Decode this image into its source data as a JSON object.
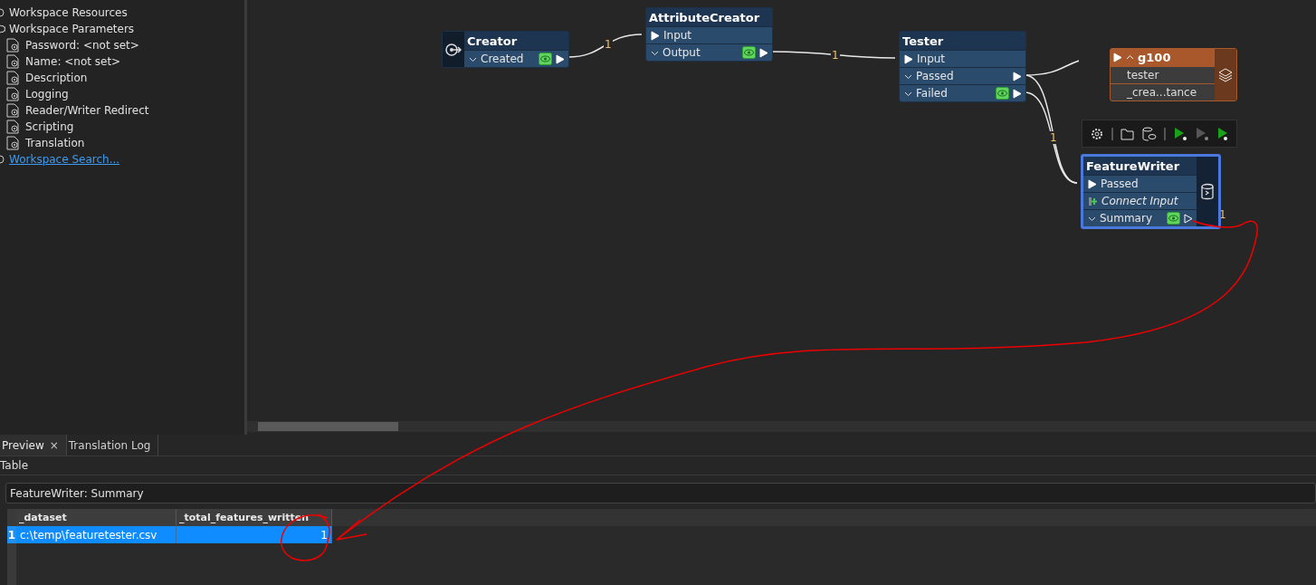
{
  "navigator": {
    "items": [
      {
        "label": "Workspace Resources",
        "kind": "resources"
      },
      {
        "label": "Workspace Parameters",
        "kind": "parameters",
        "children": [
          {
            "label": "Password: <not set>"
          },
          {
            "label": "Name: <not set>"
          },
          {
            "label": "Description"
          },
          {
            "label": "Logging"
          },
          {
            "label": "Reader/Writer Redirect"
          },
          {
            "label": "Scripting"
          },
          {
            "label": "Translation"
          }
        ]
      }
    ],
    "search_link": "Workspace Search..."
  },
  "canvas": {
    "nodes": [
      {
        "kind": "creator",
        "title": "Creator",
        "selected": false,
        "ports": [
          {
            "kind": "output",
            "label": "Created",
            "inspect": true,
            "connected": true
          }
        ]
      },
      {
        "kind": "transformer",
        "title": "AttributeCreator",
        "selected": false,
        "ports": [
          {
            "kind": "input",
            "label": "Input"
          },
          {
            "kind": "output",
            "label": "Output",
            "inspect": true,
            "connected": true
          }
        ]
      },
      {
        "kind": "transformer",
        "title": "Tester",
        "selected": false,
        "ports": [
          {
            "kind": "input",
            "label": "Input"
          },
          {
            "kind": "output",
            "label": "Passed",
            "inspect": false,
            "connected": true
          },
          {
            "kind": "output",
            "label": "Failed",
            "inspect": true,
            "connected": true
          }
        ]
      },
      {
        "kind": "writer",
        "title": "FeatureWriter",
        "selected": true,
        "ports": [
          {
            "kind": "input",
            "label": "Passed"
          },
          {
            "kind": "add",
            "label": "Connect Input"
          },
          {
            "kind": "output",
            "label": "Summary",
            "inspect": true,
            "connected": false
          }
        ]
      }
    ],
    "bookmark": {
      "title": "g100",
      "expanded": true,
      "rows": [
        "tester",
        "_crea...tance"
      ]
    },
    "connection_labels": [
      "1",
      "1",
      "1",
      "1"
    ]
  },
  "preview": {
    "tabs": [
      {
        "label": "Preview",
        "selected": true,
        "close": "×"
      },
      {
        "label": "Translation Log",
        "selected": false
      }
    ],
    "section": "Table",
    "source": "FeatureWriter: Summary",
    "table": {
      "columns": [
        "_dataset",
        "_total_features_written"
      ],
      "rows": [
        {
          "number": "1",
          "selected": true,
          "cells": [
            "c:\\temp\\featuretester.csv",
            "1"
          ]
        }
      ]
    }
  }
}
